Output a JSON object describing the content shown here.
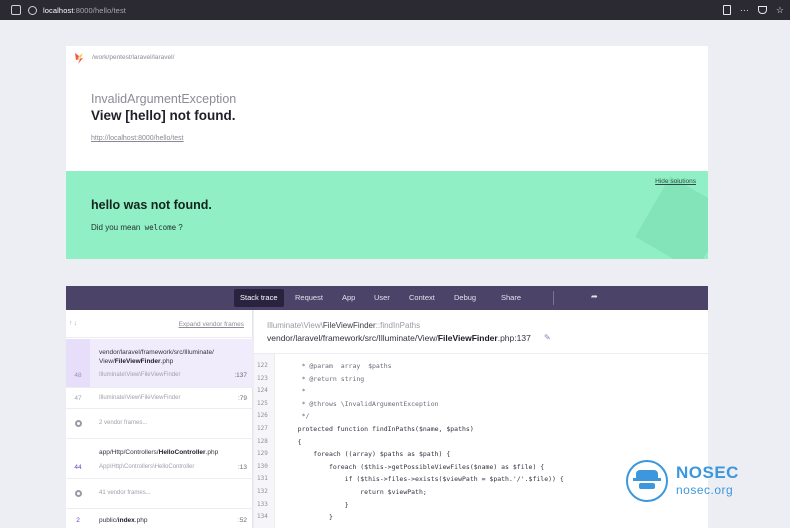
{
  "browser": {
    "url_host": "localhost",
    "url_rest": ":8000/hello/test"
  },
  "header": {
    "path": "/work/pentest/laravel/laravel/",
    "exception_class": "InvalidArgumentException",
    "exception_message": "View [hello] not found.",
    "url": "http://localhost:8000/hello/test"
  },
  "solution": {
    "hide_label": "Hide solutions",
    "title": "hello was not found.",
    "desc_prefix": "Did you mean",
    "suggestion": "welcome",
    "desc_suffix": "?",
    "bg_color": "#91efc6"
  },
  "tabs": [
    {
      "label": "Stack trace",
      "active": true
    },
    {
      "label": "Request"
    },
    {
      "label": "App"
    },
    {
      "label": "User"
    },
    {
      "label": "Context"
    },
    {
      "label": "Debug"
    },
    {
      "label": "Share"
    }
  ],
  "stack": {
    "expand_label": "Expand vendor frames",
    "frames": [
      {
        "num": "",
        "file_prefix": "vendor/laravel/framework/src/Illuminate/",
        "file_prefix2": "View/",
        "file_bold": "FileViewFinder",
        "file_ext": ".php",
        "cls": "Illuminate\\View\\FileViewFinder",
        "line": ":137",
        "num2": "48"
      },
      {
        "num": "47",
        "cls": "Illuminate\\View\\FileViewFinder",
        "line": ":79"
      },
      {
        "num": "",
        "vendor": "2 vendor frames..."
      },
      {
        "num": "44",
        "file_prefix": "app/Http/Controllers/",
        "file_bold": "HelloController",
        "file_ext": ".php",
        "cls": "App\\Http\\Controllers\\HelloController",
        "line": ":13"
      },
      {
        "num": "",
        "vendor": "41 vendor frames..."
      },
      {
        "num": "2",
        "file_prefix": "public/",
        "file_bold": "index",
        "file_ext": ".php",
        "line": ":52"
      }
    ]
  },
  "code": {
    "class_prefix": "Illuminate\\View\\",
    "class_name": "FileViewFinder",
    "method": "::findInPaths",
    "file_prefix": "vendor/laravel/framework/src/Illuminate/View/",
    "file_bold": "FileViewFinder",
    "file_suffix": ".php:137",
    "line_numbers": [
      "122",
      "123",
      "124",
      "125",
      "126",
      "127",
      "128",
      "129",
      "130",
      "131",
      "132",
      "133",
      "134"
    ],
    "lines": [
      "     * @param  array  $paths",
      "     * @return string",
      "     *",
      "     * @throws \\InvalidArgumentException",
      "     */",
      "    protected function findInPaths($name, $paths)",
      "    {",
      "        foreach ((array) $paths as $path) {",
      "            foreach ($this->getPossibleViewFiles($name) as $file) {",
      "                if ($this->files->exists($viewPath = $path.'/'.$file)) {",
      "                    return $viewPath;",
      "                }",
      "            }"
    ]
  },
  "watermark": {
    "name": "NOSEC",
    "domain": "nosec.org"
  }
}
